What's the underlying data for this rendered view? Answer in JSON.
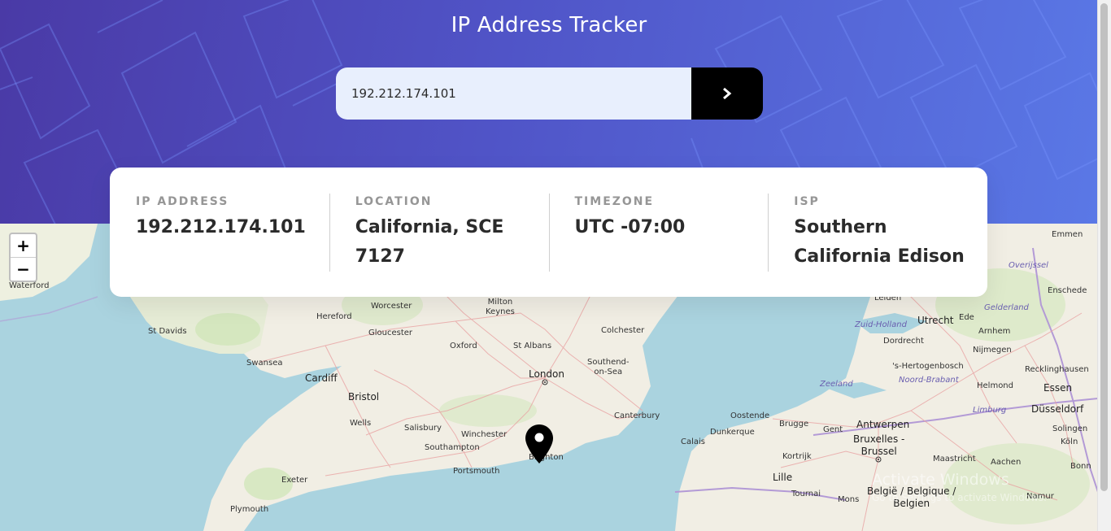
{
  "app": {
    "title": "IP Address Tracker"
  },
  "search": {
    "value": "192.212.174.101",
    "button_icon": "chevron-right-icon"
  },
  "info": [
    {
      "label": "IP ADDRESS",
      "value": "192.212.174.101"
    },
    {
      "label": "LOCATION",
      "value": "California, SCE 7127"
    },
    {
      "label": "TIMEZONE",
      "value": "UTC -07:00"
    },
    {
      "label": "ISP",
      "value": "Southern California Edison"
    }
  ],
  "map": {
    "zoom_in": "+",
    "zoom_out": "−",
    "marker_icon": "map-pin-icon",
    "labels": {
      "waterford": "Waterford",
      "emmen": "Emmen",
      "overijssel": "Overijssel",
      "enschede": "Enschede",
      "leiden": "Leiden",
      "gelderland": "Gelderland",
      "hereford": "Hereford",
      "worcester": "Worcester",
      "milton_keynes": "Milton\nKeynes",
      "colchester": "Colchester",
      "zuid_holland": "Zuid-Holland",
      "utrecht": "Utrecht",
      "ede": "Ede",
      "arnhem": "Arnhem",
      "st_davids": "St Davids",
      "gloucester": "Gloucester",
      "dordrecht": "Dordrecht",
      "oxford": "Oxford",
      "st_albans": "St Albans",
      "nijmegen": "Nijmegen",
      "s_hertogenbosch": "'s-Hertogenbosch",
      "southend": "Southend-\non-Sea",
      "swansea": "Swansea",
      "recklinghausen": "Recklinghausen",
      "london": "London",
      "cardiff": "Cardiff",
      "zeeland": "Zeeland",
      "noord_brabant": "Noord-Brabant",
      "helmond": "Helmond",
      "essen": "Essen",
      "bristol": "Bristol",
      "duisburg": "Düsseldorf",
      "oostende": "Oostende",
      "brugge": "Brugge",
      "gent": "Gent",
      "antwerpen": "Antwerpen",
      "limburg": "Limburg",
      "canterbury": "Canterbury",
      "wells": "Wells",
      "salisbury": "Salisbury",
      "winchester": "Winchester",
      "dunkerque": "Dunkerque",
      "solingen": "Solingen",
      "bruxelles": "Bruxelles -\nBrussel",
      "calais": "Calais",
      "southampton": "Southampton",
      "koln": "Köln",
      "kortrijk": "Kortrijk",
      "brighton": "Brighton",
      "maastricht": "Maastricht",
      "aachen": "Aachen",
      "portsmouth": "Portsmouth",
      "lille": "Lille",
      "bonn": "Bonn",
      "exeter": "Exeter",
      "belgie": "België / Belgique /\nBelgien",
      "tournai": "Tournai",
      "mons": "Mons",
      "namur": "Namur",
      "plymouth": "Plymouth"
    }
  },
  "overlay": {
    "activate": "Activate Windows",
    "activate_sub": "Go to Settings to activate Windows."
  }
}
